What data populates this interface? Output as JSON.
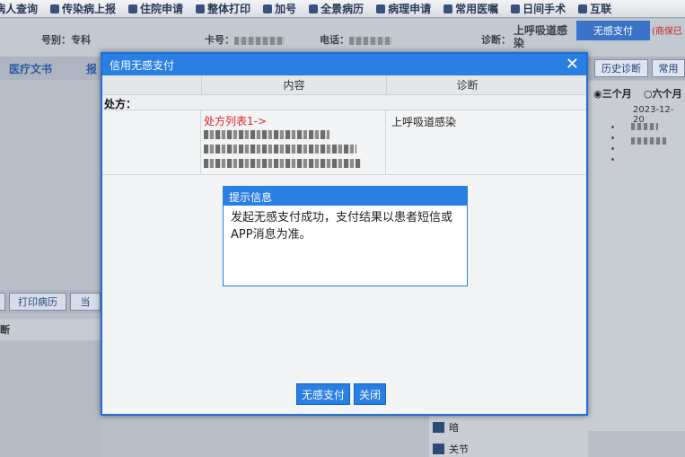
{
  "toolbar": {
    "items": [
      {
        "label": "病人查询"
      },
      {
        "label": "传染病上报"
      },
      {
        "label": "住院申请"
      },
      {
        "label": "整体打印"
      },
      {
        "label": "加号"
      },
      {
        "label": "全景病历"
      },
      {
        "label": "病理申请"
      },
      {
        "label": "常用医嘱"
      },
      {
        "label": "日间手术"
      },
      {
        "label": "互联"
      }
    ]
  },
  "patient_info": {
    "dept_label": "号别：专科",
    "card_label": "卡号：",
    "phone_label": "电话：",
    "diagnosis_label": "诊断：",
    "diagnosis_value": "上呼吸道感染",
    "button_label": "无感支付",
    "red_text": "(商保已"
  },
  "tabs": {
    "left_label": "医疗文书",
    "left_label_2": "报",
    "history_tab": "历史诊断",
    "common_tab": "常用"
  },
  "right_panel": {
    "radio_3m": "三个月",
    "radio_6m": "六个月",
    "date": "2023-12-20"
  },
  "left_panel": {
    "print_button": "打印病历",
    "button_2": "当",
    "row_label": "断"
  },
  "bottom_list": {
    "item_1": "暗",
    "item_2": "关节"
  },
  "modal": {
    "title": "信用无感支付",
    "columns": [
      "",
      "内容",
      "诊断"
    ],
    "section_label": "处方：",
    "prescription_link": "处方列表1->",
    "diagnosis": "上呼吸道感染",
    "tip": {
      "title": "提示信息",
      "message": "发起无感支付成功，支付结果以患者短信或APP消息为准。"
    },
    "buttons": {
      "pay": "无感支付",
      "close": "关闭"
    }
  },
  "colors": {
    "accent": "#2a7fe3",
    "link_red": "#e02424"
  }
}
